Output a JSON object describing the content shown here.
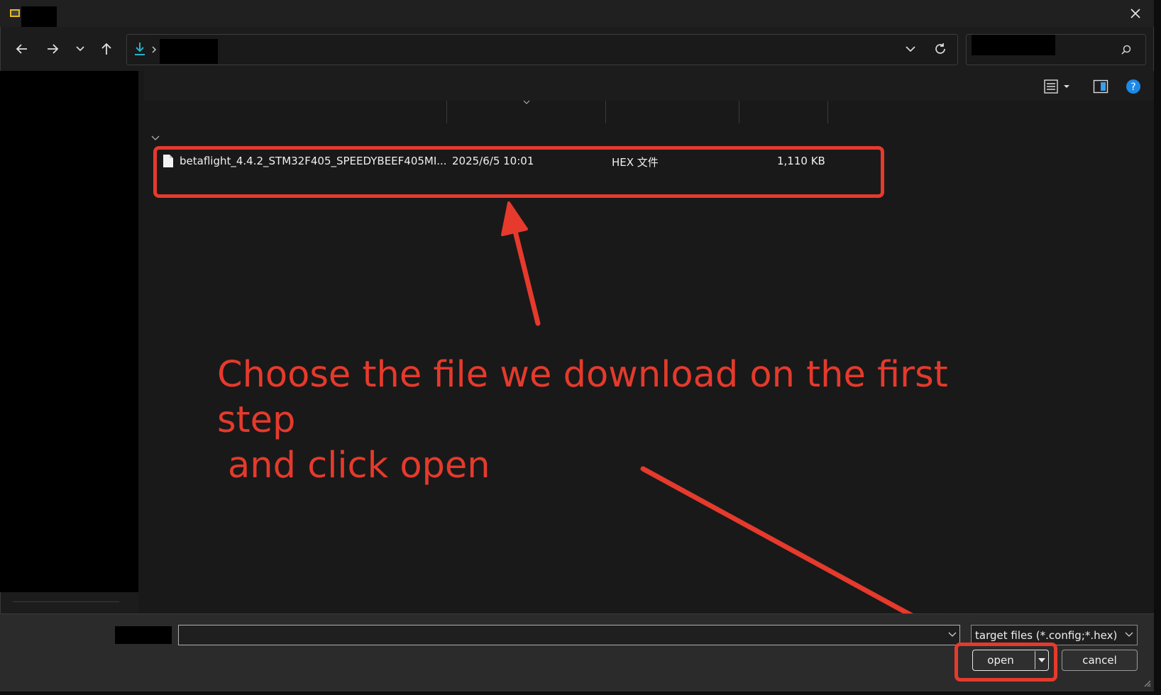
{
  "file_row": {
    "name": "betaflight_4.4.2_STM32F405_SPEEDYBEEF405MI...",
    "date": "2025/6/5 10:01",
    "type": "HEX 文件",
    "size": "1,110 KB"
  },
  "annotation": {
    "line1": "Choose the file we download on the first step",
    "line2": "and click open",
    "color": "#e53a2c"
  },
  "bottom": {
    "filetype_value": "target files (*.config;*.hex)",
    "open_label": "open",
    "cancel_label": "cancel"
  },
  "icons": {
    "close": "close-icon",
    "back": "back-arrow-icon",
    "forward": "forward-arrow-icon",
    "recent": "chevron-down-icon",
    "up": "up-arrow-icon",
    "downloads": "download-icon",
    "refresh": "refresh-icon",
    "search": "search-icon",
    "view": "view-list-icon",
    "preview": "preview-pane-icon",
    "help": "help-icon"
  }
}
